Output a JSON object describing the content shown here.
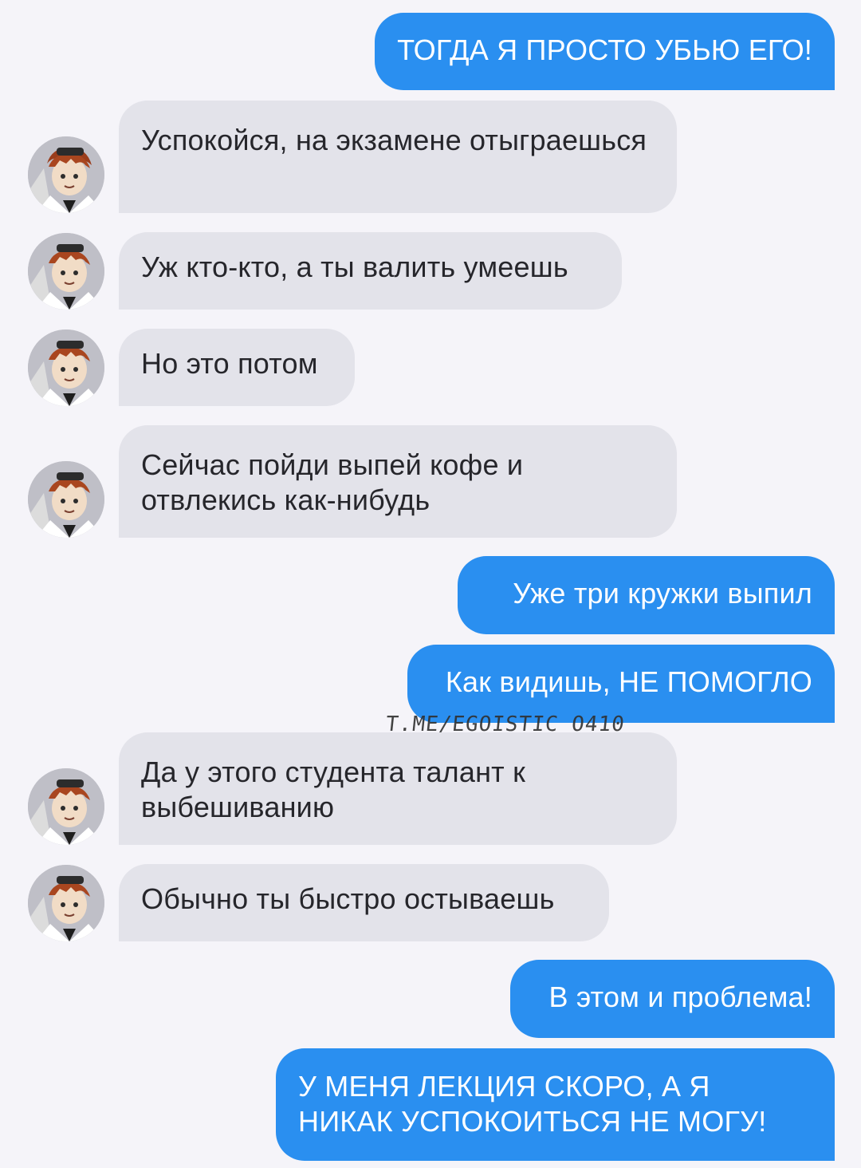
{
  "messages": [
    {
      "side": "out",
      "text": "ТОГДА Я ПРОСТО УБЬЮ ЕГО!"
    },
    {
      "side": "in",
      "text": "Успокойся, на экзамене отыграешься"
    },
    {
      "side": "in",
      "text": "Уж кто-кто, а ты валить умеешь"
    },
    {
      "side": "in",
      "text": "Но это потом"
    },
    {
      "side": "in",
      "text": "Сейчас пойди выпей кофе и отвлекись как-нибудь"
    },
    {
      "side": "out",
      "text": "Уже три кружки выпил"
    },
    {
      "side": "out",
      "text": "Как видишь, НЕ ПОМОГЛО"
    },
    {
      "side": "in",
      "text": "Да у этого студента талант к выбешиванию"
    },
    {
      "side": "in",
      "text": "Обычно ты быстро остываешь"
    },
    {
      "side": "out",
      "text": "В этом и проблема!"
    },
    {
      "side": "out",
      "text": "У МЕНЯ ЛЕКЦИЯ СКОРО, А Я НИКАК УСПОКОИТЬСЯ НЕ МОГУ!"
    }
  ],
  "watermark": "T.ME/EGOISTIC_O410",
  "colors": {
    "background": "#f5f4f9",
    "incoming_bubble": "#e3e3ea",
    "outgoing_bubble": "#2a8ff0"
  },
  "icons": {
    "avatar": "anime-character-avatar"
  }
}
